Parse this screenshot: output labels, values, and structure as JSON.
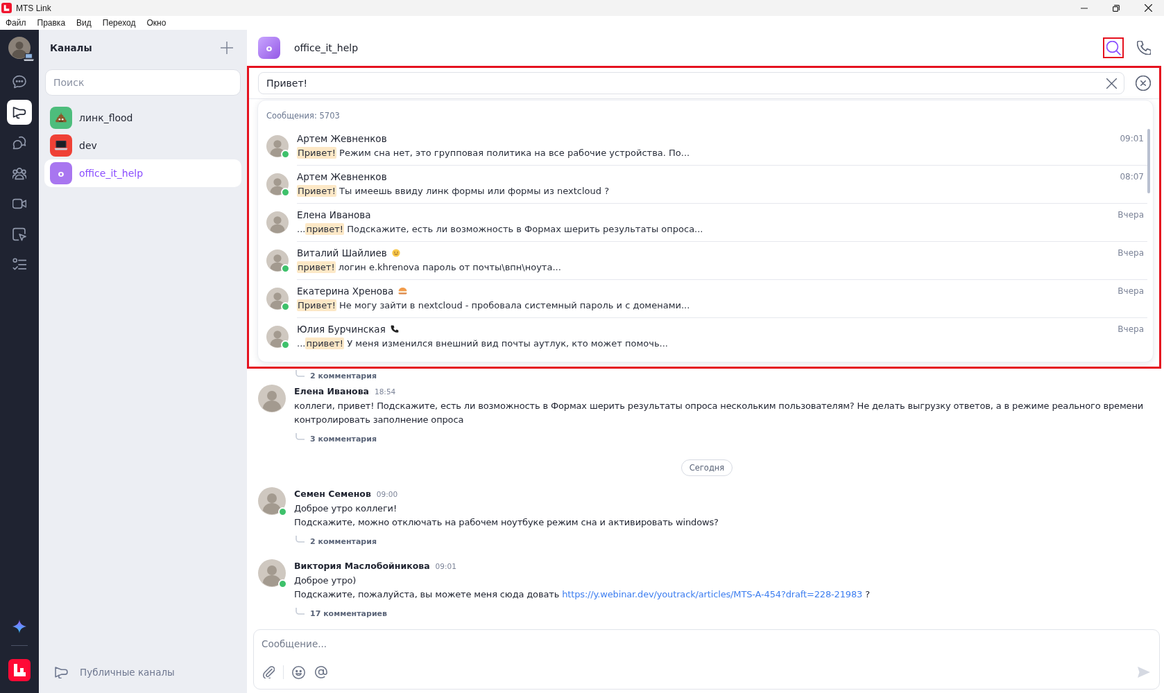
{
  "window": {
    "title": "MTS Link"
  },
  "menu": [
    "Файл",
    "Правка",
    "Вид",
    "Переход",
    "Окно"
  ],
  "rail": {
    "items": [
      {
        "kind": "chats",
        "selected": false
      },
      {
        "kind": "channels",
        "selected": true
      },
      {
        "kind": "threads",
        "selected": false
      },
      {
        "kind": "contacts",
        "selected": false
      },
      {
        "kind": "meetings",
        "selected": false
      },
      {
        "kind": "board",
        "selected": false
      },
      {
        "kind": "tasks",
        "selected": false
      }
    ]
  },
  "channels_panel": {
    "title": "Каналы",
    "search": {
      "placeholder": "Поиск"
    },
    "items": [
      {
        "name": "линк_flood",
        "kind": "pile",
        "color": "#4dbd7c",
        "selected": false
      },
      {
        "name": "dev",
        "kind": "laptop",
        "color": "#ef4136",
        "selected": false
      },
      {
        "name": "office_it_help",
        "kind": "letter",
        "letter": "o",
        "color": "#a876f0",
        "selected": true
      }
    ],
    "footer": "Публичные каналы"
  },
  "header": {
    "letter": "o",
    "title": "office_it_help",
    "search_button": {
      "active": true,
      "highlighted": true
    }
  },
  "search": {
    "value": "Привет!",
    "highlighted": true,
    "count": "Сообщения: 5703",
    "results": [
      {
        "kind": "plain",
        "author": "Артем Жевненков",
        "online": true,
        "match": "Привет!",
        "after": " Режим сна нет, это групповая политика на все рабочие устройства. По...",
        "time": "09:01"
      },
      {
        "kind": "plain",
        "author": "Артем Жевненков",
        "online": true,
        "match": "Привет!",
        "after": " Ты имеешь ввиду линк формы или формы из nextcloud ?",
        "time": "08:07"
      },
      {
        "kind": "plain",
        "author": "Елена Иванова",
        "online": false,
        "before": "...",
        "match": "привет!",
        "after": " Подскажите, есть ли возможность в Формах шерить результаты опроса...",
        "time": "Вчера"
      },
      {
        "kind": "smiley",
        "author": "Виталий Шайлиев",
        "online": true,
        "match": "привет!",
        "after": " логин e.khrenova пароль от почты\\впн\\ноута...",
        "time": "Вчера"
      },
      {
        "kind": "burger",
        "author": "Екатерина Хренова",
        "online": true,
        "match": "Привет!",
        "after": " Не могу зайти в nextcloud - пробовала системный пароль и с доменами...",
        "time": "Вчера"
      },
      {
        "kind": "phone",
        "author": "Юлия Бурчинская",
        "online": true,
        "before": "...",
        "match": "привет!",
        "after": " У меня изменился внешний вид почты аутлук, кто может помочь...",
        "time": "Вчера"
      }
    ]
  },
  "feed": {
    "hidden_comments": "2 комментария",
    "items": [
      {
        "kind": "message",
        "author": "Елена Иванова",
        "time": "18:54",
        "online": false,
        "paragraphs": [
          {
            "text": "коллеги, привет! Подскажите, есть ли возможность в Формах шерить результаты опроса нескольким пользователям? Не делать выгрузку ответов, а в режиме реального времени контролировать заполнение опроса"
          }
        ],
        "comments": "3 комментария"
      },
      {
        "kind": "date",
        "label": "Сегодня"
      },
      {
        "kind": "message",
        "author": "Семен Семенов",
        "time": "09:00",
        "online": true,
        "paragraphs": [
          {
            "text": "Доброе утро коллеги!"
          },
          {
            "text": "Подскажите, можно отключать на рабочем ноутбуке режим сна и активировать windows?"
          }
        ],
        "comments": "2 комментария"
      },
      {
        "kind": "message",
        "author": "Виктория Маслобойникова",
        "time": "09:01",
        "online": true,
        "paragraphs": [
          {
            "text": "Доброе утро)"
          },
          {
            "text": "Подскажите, пожалуйста, вы можете меня сюда довать ",
            "link": "https://y.webinar.dev/youtrack/articles/MTS-A-454?draft=228-21983",
            "tail": " ?"
          }
        ],
        "comments": "17 комментариев"
      }
    ]
  },
  "composer": {
    "placeholder": "Сообщение...",
    "send_enabled": false
  }
}
